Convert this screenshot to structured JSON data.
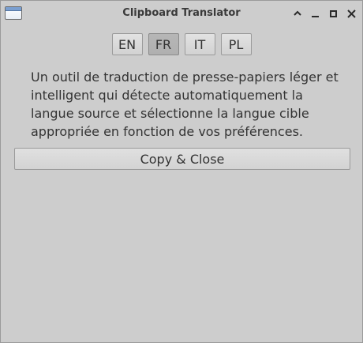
{
  "window": {
    "title": "Clipboard Translator",
    "controls": [
      "chevron-up-icon",
      "minimize-icon",
      "maximize-icon",
      "close-icon"
    ]
  },
  "languages": [
    {
      "label": "EN",
      "active": false
    },
    {
      "label": "FR",
      "active": true
    },
    {
      "label": "IT",
      "active": false
    },
    {
      "label": "PL",
      "active": false
    }
  ],
  "description": "Un outil de traduction de presse-papiers léger et intelligent qui détecte automatiquement la langue source et sélectionne la langue cible appropriée en fonction de vos préférences.",
  "copy_button": "Copy & Close",
  "colors": {
    "background": "#cdcdcd",
    "active_button": "#b3b3b3"
  }
}
